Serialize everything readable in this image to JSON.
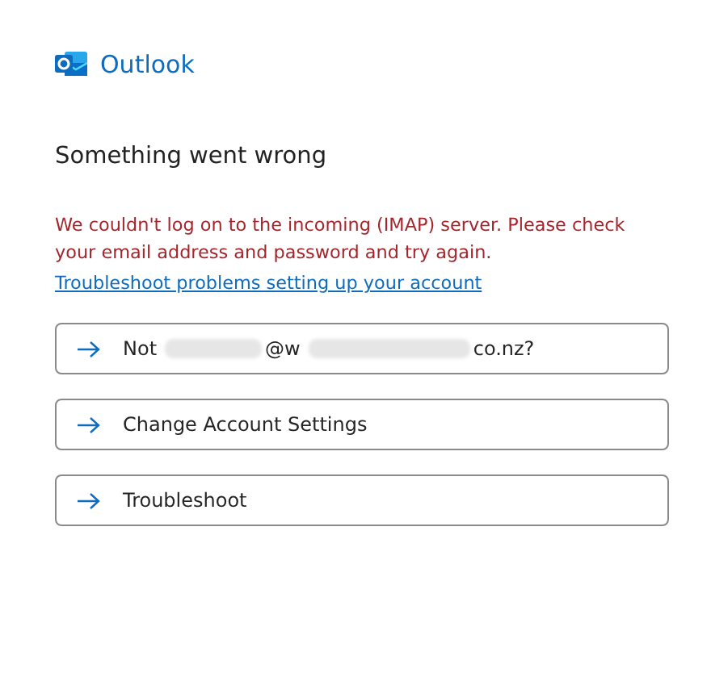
{
  "app": {
    "name": "Outlook"
  },
  "heading": "Something went wrong",
  "error": "We couldn't log on to the incoming (IMAP) server. Please check your email address and password and try again.",
  "help_link": "Troubleshoot problems setting up your account",
  "actions": [
    {
      "parts": [
        {
          "kind": "text",
          "text": "Not"
        },
        {
          "kind": "redacted"
        },
        {
          "kind": "text",
          "text": "@w"
        },
        {
          "kind": "redacted"
        },
        {
          "kind": "text",
          "text": "co.nz?"
        }
      ]
    },
    {
      "parts": [
        {
          "kind": "text",
          "text": "Change Account Settings"
        }
      ]
    },
    {
      "parts": [
        {
          "kind": "text",
          "text": "Troubleshoot"
        }
      ]
    }
  ]
}
